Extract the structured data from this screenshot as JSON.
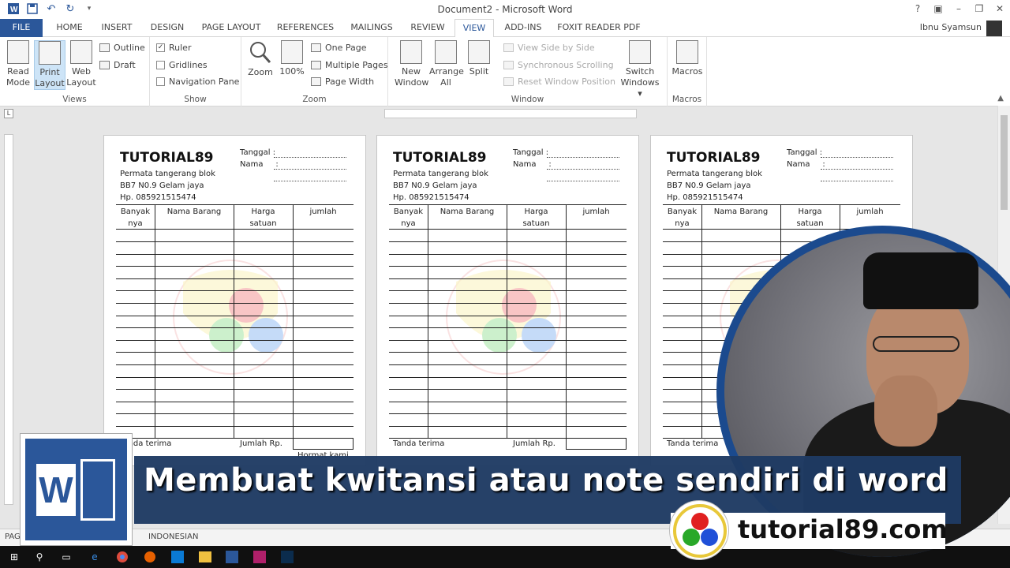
{
  "window": {
    "title": "Document2 - Microsoft Word",
    "user": "Ibnu Syamsun"
  },
  "qat": {
    "save": "save-icon",
    "undo": "undo-icon",
    "redo": "redo-icon",
    "more": "▾"
  },
  "tabs": [
    "FILE",
    "HOME",
    "INSERT",
    "DESIGN",
    "PAGE LAYOUT",
    "REFERENCES",
    "MAILINGS",
    "REVIEW",
    "VIEW",
    "ADD-INS",
    "FOXIT READER PDF"
  ],
  "active_tab": "VIEW",
  "ribbon": {
    "views": {
      "label": "Views",
      "read_mode": [
        "Read",
        "Mode"
      ],
      "print_layout": [
        "Print",
        "Layout"
      ],
      "web_layout": [
        "Web",
        "Layout"
      ],
      "outline": "Outline",
      "draft": "Draft"
    },
    "show": {
      "label": "Show",
      "ruler": "Ruler",
      "gridlines": "Gridlines",
      "nav_pane": "Navigation Pane"
    },
    "zoom": {
      "label": "Zoom",
      "zoom": "Zoom",
      "hundred": "100%",
      "one_page": "One Page",
      "multiple_pages": "Multiple Pages",
      "page_width": "Page Width"
    },
    "window": {
      "label": "Window",
      "new_window": [
        "New",
        "Window"
      ],
      "arrange_all": [
        "Arrange",
        "All"
      ],
      "split": "Split",
      "side_by_side": "View Side by Side",
      "sync_scroll": "Synchronous Scrolling",
      "reset_pos": "Reset Window Position",
      "switch": [
        "Switch",
        "Windows ▾"
      ]
    },
    "macros": {
      "label": "Macros",
      "macros": "Macros"
    }
  },
  "receipt": {
    "shop": "TUTORIAL89",
    "addr1": "Permata tangerang blok",
    "addr2": "BB7 N0.9 Gelam jaya",
    "phone": "Hp. 085921515474",
    "tanggal": "Tanggal :",
    "nama": "Nama     :",
    "col1": [
      "Banyak",
      "nya"
    ],
    "col2": "Nama Barang",
    "col3": [
      "Harga",
      "satuan"
    ],
    "col4": "jumlah",
    "tanda": "Tanda terima",
    "jumlah_rp": "Jumlah Rp.",
    "hormat": "Hormat kami"
  },
  "status": {
    "page": "PAG",
    "language": "INDONESIAN"
  },
  "banner": {
    "text": "Membuat kwitansi atau note sendiri di word",
    "site": "tutorial89.com",
    "word_letter": "W"
  },
  "colors": {
    "word_blue": "#2b579a",
    "banner": "#1e3a63",
    "ring": "#1b4a8e"
  }
}
